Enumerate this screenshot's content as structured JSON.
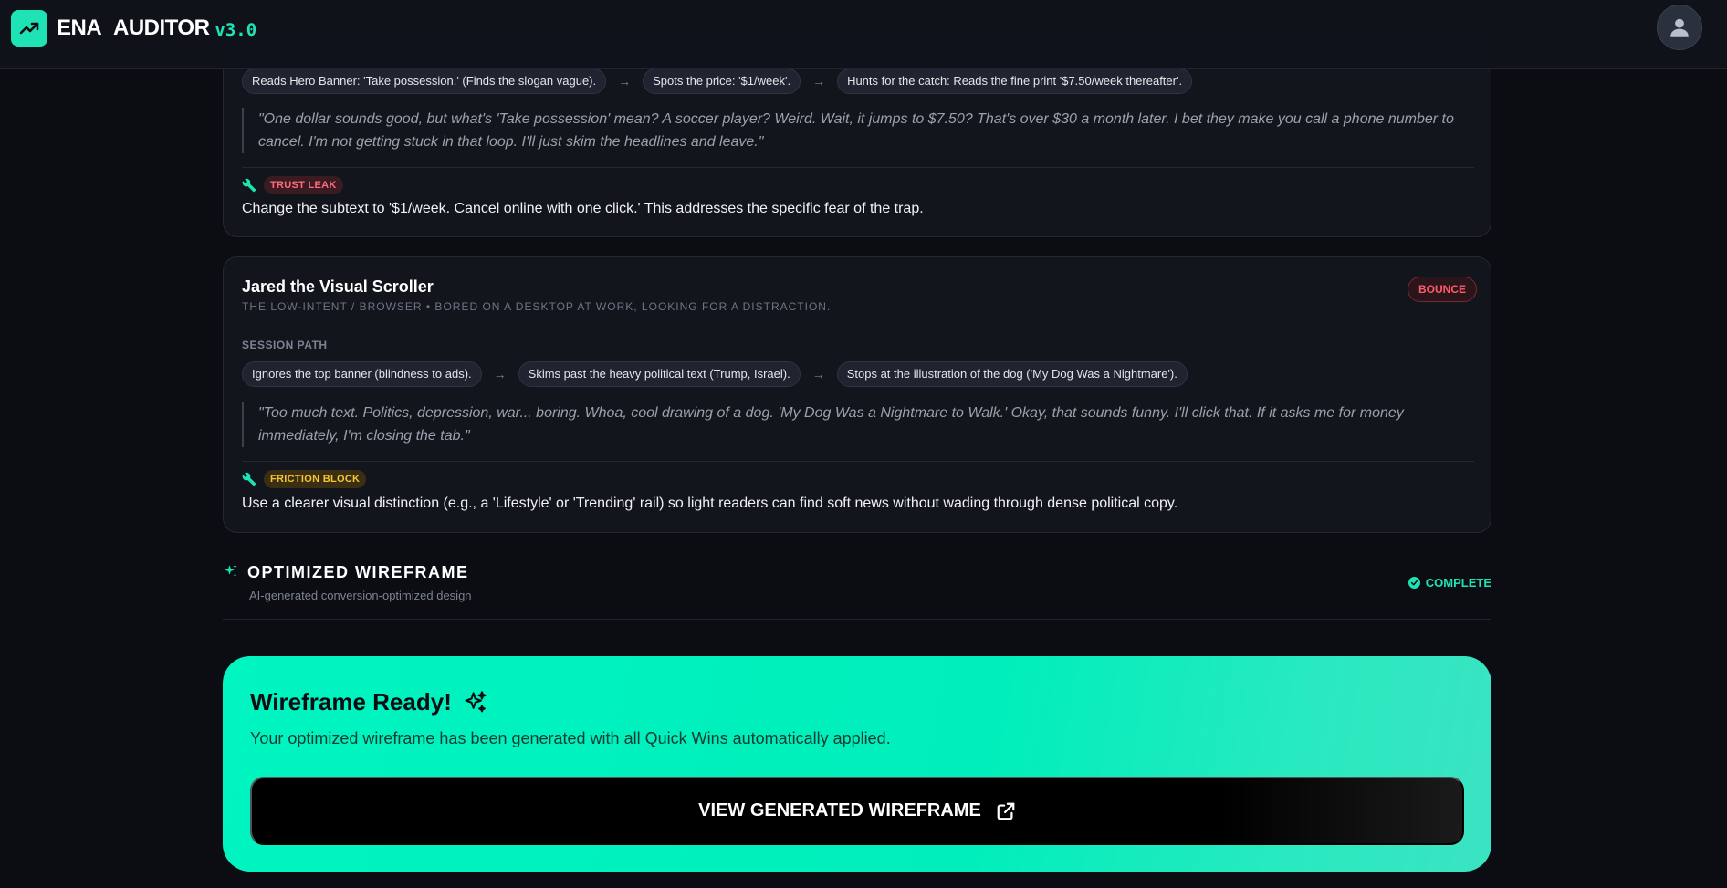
{
  "app": {
    "name": "ENA_AUDITOR",
    "version": "v3.0"
  },
  "persona_prev": {
    "path": [
      "Reads Hero Banner: 'Take possession.' (Finds the slogan vague).",
      "Spots the price: '$1/week'.",
      "Hunts for the catch: Reads the fine print '$7.50/week thereafter'."
    ],
    "quote": "\"One dollar sounds good, but what's 'Take possession' mean? A soccer player? Weird. Wait, it jumps to $7.50? That's over $30 a month later. I bet they make you call a phone number to cancel. I'm not getting stuck in that loop. I'll just skim the headlines and leave.\"",
    "fix_badge": "TRUST LEAK",
    "fix_text": "Change the subtext to '$1/week. Cancel online with one click.' This addresses the specific fear of the trap."
  },
  "persona_jared": {
    "name": "Jared the Visual Scroller",
    "subtitle": "THE LOW-INTENT / BROWSER • BORED ON A DESKTOP AT WORK, LOOKING FOR A DISTRACTION.",
    "outcome": "BOUNCE",
    "session_label": "SESSION PATH",
    "path": [
      "Ignores the top banner (blindness to ads).",
      "Skims past the heavy political text (Trump, Israel).",
      "Stops at the illustration of the dog ('My Dog Was a Nightmare')."
    ],
    "quote": "\"Too much text. Politics, depression, war... boring. Whoa, cool drawing of a dog. 'My Dog Was a Nightmare to Walk.' Okay, that sounds funny. I'll click that. If it asks me for money immediately, I'm closing the tab.\"",
    "fix_badge": "FRICTION BLOCK",
    "fix_text": "Use a clearer visual distinction (e.g., a 'Lifestyle' or 'Trending' rail) so light readers can find soft news without wading through dense political copy."
  },
  "wireframe_section": {
    "title": "OPTIMIZED WIREFRAME",
    "subtitle": "AI-generated conversion-optimized design",
    "status": "COMPLETE"
  },
  "ready_banner": {
    "title": "Wireframe Ready!",
    "description": "Your optimized wireframe has been generated with all Quick Wins automatically applied.",
    "button_label": "VIEW GENERATED WIREFRAME"
  },
  "colors": {
    "accent": "#1ee3b4",
    "background": "#0b0d12",
    "card": "#12151c",
    "danger": "#ff5a6c",
    "warning": "#f7c531"
  },
  "icons": [
    "trending-up-icon",
    "user-icon",
    "wrench-icon",
    "sparkles-icon",
    "check-circle-icon",
    "external-link-icon"
  ]
}
